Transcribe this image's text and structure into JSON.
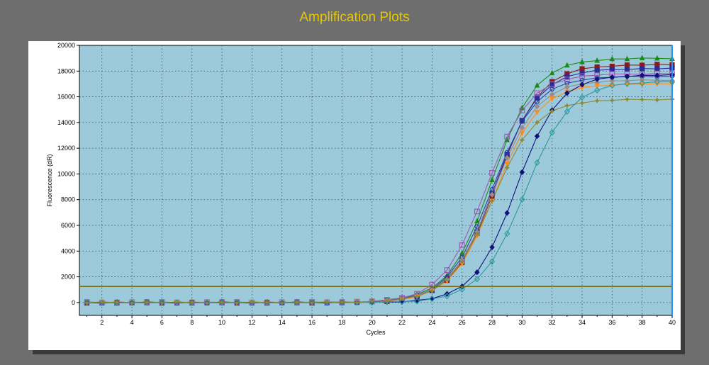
{
  "title": "Amplification Plots",
  "colors": {
    "background": "#6e6e6e",
    "plot_area": "#9ccadb",
    "threshold": "#7a6e14",
    "cursor": "#2d8ff0",
    "title": "#e8c800"
  },
  "chart_data": {
    "type": "line",
    "xlabel": "Cycles",
    "ylabel": "Fluorescence (dR)",
    "xlim": [
      0.5,
      40
    ],
    "ylim": [
      -1000,
      20000
    ],
    "x_ticks": [
      2,
      4,
      6,
      8,
      10,
      12,
      14,
      16,
      18,
      20,
      22,
      24,
      26,
      28,
      30,
      32,
      34,
      36,
      38,
      40
    ],
    "y_ticks": [
      0,
      2000,
      4000,
      6000,
      8000,
      10000,
      12000,
      14000,
      16000,
      18000,
      20000
    ],
    "grid": true,
    "threshold": 1250,
    "vertical_cursor_x": 40,
    "series": [
      {
        "color": "#1b8a1b",
        "marker": "triangle",
        "plateau": 19000,
        "midpoint": 28.0,
        "slope": 1.45
      },
      {
        "color": "#8b1a1a",
        "marker": "square",
        "plateau": 18500,
        "midpoint": 28.3,
        "slope": 1.45
      },
      {
        "color": "#2a2a9a",
        "marker": "square",
        "plateau": 18200,
        "midpoint": 28.2,
        "slope": 1.45
      },
      {
        "color": "#9b59b6",
        "marker": "square-open",
        "plateau": 17800,
        "midpoint": 27.6,
        "slope": 1.45
      },
      {
        "color": "#333fa0",
        "marker": "circle-open",
        "plateau": 17600,
        "midpoint": 28.0,
        "slope": 1.45
      },
      {
        "color": "#9a8a8a",
        "marker": "diamond",
        "plateau": 17300,
        "midpoint": 28.1,
        "slope": 1.45
      },
      {
        "color": "#ff8c1a",
        "marker": "triangle-down",
        "plateau": 17000,
        "midpoint": 28.2,
        "slope": 1.45
      },
      {
        "color": "#10107a",
        "marker": "diamond",
        "plateau": 17700,
        "midpoint": 29.6,
        "slope": 1.4
      },
      {
        "color": "#2b9aa0",
        "marker": "diamond-open",
        "plateau": 17200,
        "midpoint": 30.2,
        "slope": 1.5
      },
      {
        "color": "#8a8a3a",
        "marker": "star",
        "plateau": 15800,
        "midpoint": 28.0,
        "slope": 1.45
      }
    ]
  }
}
